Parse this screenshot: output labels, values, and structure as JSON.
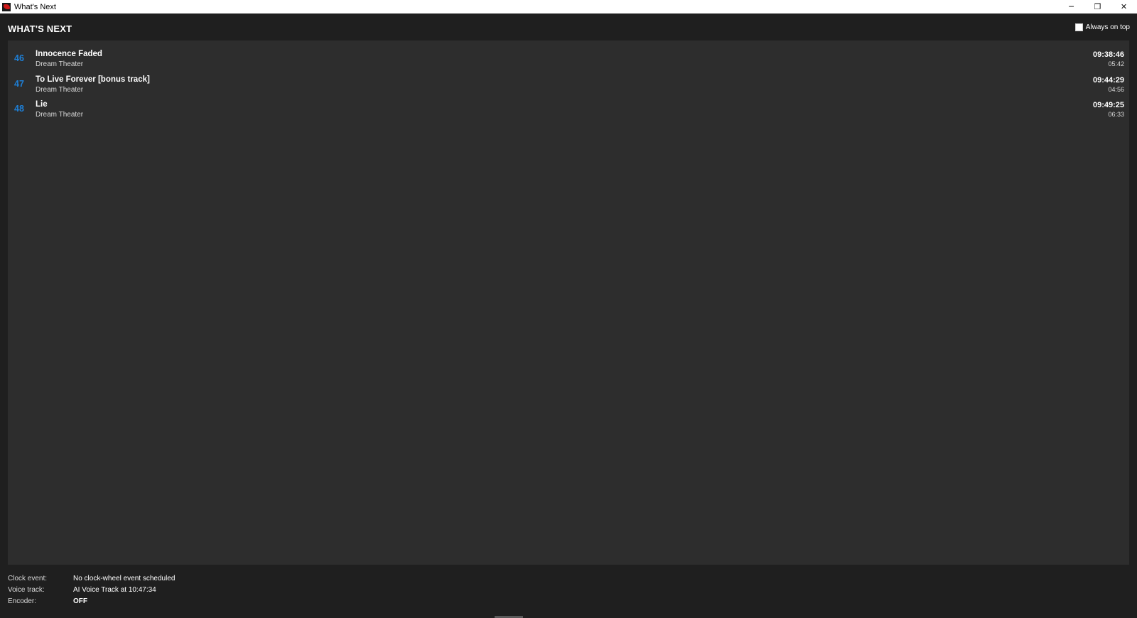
{
  "window": {
    "title": "What's Next",
    "minimize_glyph": "─",
    "restore_glyph": "❐",
    "close_glyph": "✕"
  },
  "header": {
    "title": "WHAT'S NEXT",
    "always_on_top_label": "Always on top",
    "always_on_top_checked": false
  },
  "queue": [
    {
      "number": "46",
      "title": "Innocence Faded",
      "artist": "Dream Theater",
      "start_time": "09:38:46",
      "duration": "05:42"
    },
    {
      "number": "47",
      "title": "To Live Forever [bonus track]",
      "artist": "Dream Theater",
      "start_time": "09:44:29",
      "duration": "04:56"
    },
    {
      "number": "48",
      "title": "Lie",
      "artist": "Dream Theater",
      "start_time": "09:49:25",
      "duration": "06:33"
    }
  ],
  "status": {
    "clock_event_label": "Clock event:",
    "clock_event_value": "No clock-wheel event scheduled",
    "voice_track_label": "Voice track:",
    "voice_track_value": "AI Voice Track at 10:47:34",
    "encoder_label": "Encoder:",
    "encoder_value": "OFF"
  },
  "colors": {
    "accent_number": "#1e7fd6",
    "panel_bg": "#2d2d2d",
    "window_bg": "#1f1f1f"
  }
}
